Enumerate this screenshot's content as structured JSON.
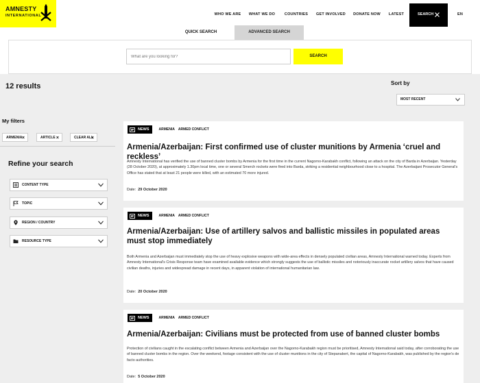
{
  "header": {
    "logo_line1": "AMNESTY",
    "logo_line2": "INTERNATIONAL",
    "nav": [
      "WHO WE ARE",
      "WHAT WE DO",
      "COUNTRIES",
      "GET INVOLVED",
      "DONATE NOW",
      "LATEST"
    ],
    "search_label": "SEARCH",
    "lang": "EN"
  },
  "search": {
    "tab_quick": "QUICK SEARCH",
    "tab_advanced": "ADVANCED SEARCH",
    "placeholder": "What are you looking for?",
    "button": "SEARCH"
  },
  "results": {
    "count_text": "12 results",
    "sort_label": "Sort by",
    "sort_value": "MOST RECENT"
  },
  "filters": {
    "title": "My filters",
    "chips": [
      "ARMENIA",
      "ARTICLE",
      "CLEAR ALL"
    ],
    "refine_title": "Refine your search",
    "groups": [
      "CONTENT TYPE",
      "TOPIC",
      "REGION / COUNTRY",
      "RESOURCE TYPE"
    ]
  },
  "articles": [
    {
      "type": "NEWS",
      "tags": [
        "ARMENIA",
        "ARMED CONFLICT"
      ],
      "title": "Armenia/Azerbaijan: First confirmed use of cluster munitions by Armenia ‘cruel and reckless’",
      "excerpt": "Amnesty International has verified the use of banned cluster bombs by Armenia for the first time in the current Nagorno-Karabakh conflict, following an attack on the city of Barda in Azerbaijan. Yesterday (28 October 2020), at approximately 1.30pm local time, one or several Smerch rockets were fired into Barda, striking a residential neighbourhood close to a hospital. The Azerbaijani Prosecutor General's Office has stated that at least 21 people were killed, with an estimated 70 more injured.",
      "date_label": "Date:",
      "date": "29 October 2020"
    },
    {
      "type": "NEWS",
      "tags": [
        "ARMENIA",
        "ARMED CONFLICT"
      ],
      "title": "Armenia/Azerbaijan: Use of artillery salvos and ballistic missiles in populated areas must stop immediately",
      "excerpt": "Both Armenia and Azerbaijan must immediately stop the use of heavy explosive weapons with wide-area effects in densely populated civilian areas, Amnesty International warned today. Experts from Amnesty International's Crisis Response team have examined available evidence which strongly suggests the use of ballistic missiles and notoriously inaccurate rocket artillery salvos that have caused civilian deaths, injuries and widespread damage in recent days, in apparent violation of international humanitarian law.",
      "date_label": "Date:",
      "date": "20 October 2020"
    },
    {
      "type": "NEWS",
      "tags": [
        "ARMENIA",
        "ARMED CONFLICT"
      ],
      "title": "Armenia/Azerbaijan: Civilians must be protected from use of banned cluster bombs",
      "excerpt": "Protection of civilians caught in the escalating conflict between Armenia and Azerbaijan over the Nagorno-Karabakh region must be prioritised, Amnesty International said today, after corroborating the use of banned cluster bombs in the region. Over the weekend, footage consistent with the use of cluster munitions in the city of Stepanakert, the capital of Nagorno-Karabakh, was published by the region's de facto authorities.",
      "date_label": "Date:",
      "date": "5 October 2020"
    }
  ]
}
